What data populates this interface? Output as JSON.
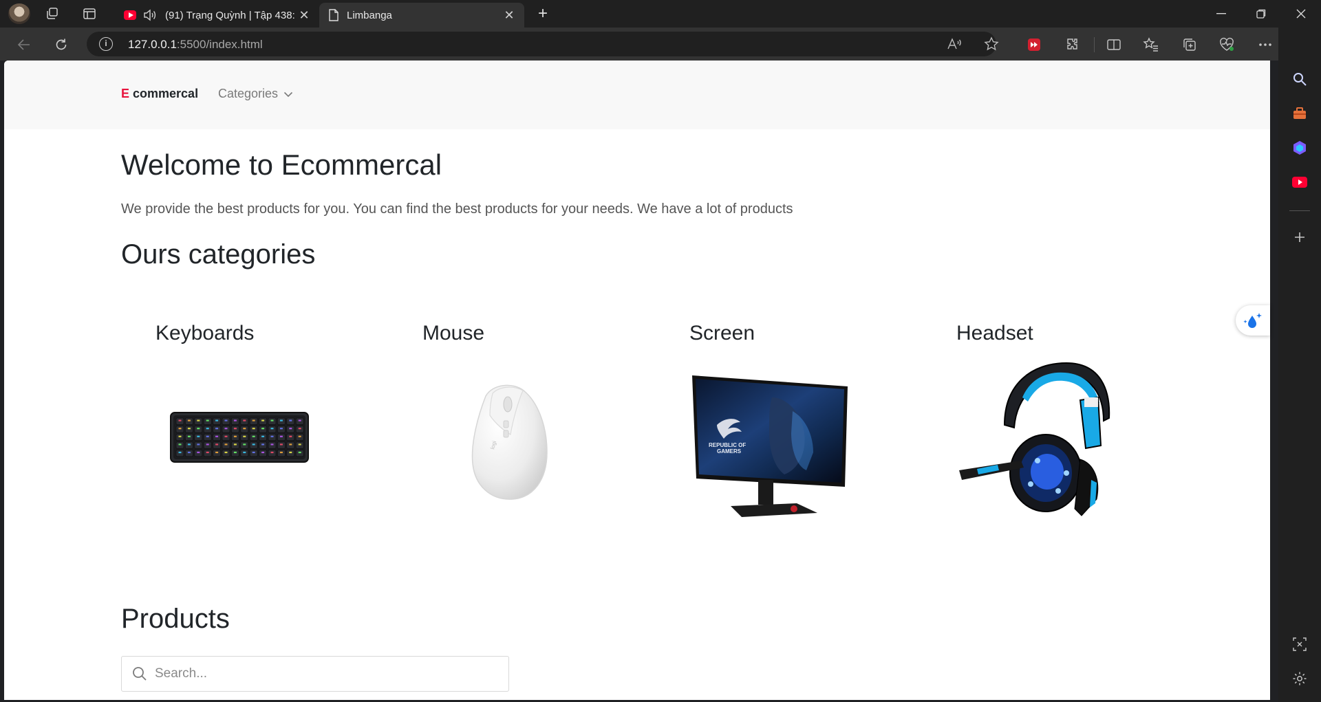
{
  "browser": {
    "tabs": [
      {
        "title": "(91) Trạng Quỳnh | Tập 438:",
        "favicon": "youtube-icon",
        "audio": true
      },
      {
        "title": "Limbanga",
        "favicon": "document-icon",
        "active": true
      }
    ],
    "address": {
      "host": "127.0.0.1",
      "path": ":5500/index.html"
    },
    "accent": "#ff0033"
  },
  "nav": {
    "brand_e": "E",
    "brand_rest": " commercal",
    "categories_label": "Categories"
  },
  "hero": {
    "title": "Welcome to Ecommercal",
    "lead": "We provide the best products for you. You can find the best products for your needs. We have a lot of products"
  },
  "categories": {
    "heading": "Ours categories",
    "items": [
      {
        "label": "Keyboards",
        "icon": "keyboard-image"
      },
      {
        "label": "Mouse",
        "icon": "mouse-image"
      },
      {
        "label": "Screen",
        "icon": "monitor-image"
      },
      {
        "label": "Headset",
        "icon": "headset-image"
      }
    ]
  },
  "products": {
    "heading": "Products",
    "search_placeholder": "Search..."
  },
  "colors": {
    "brand_red": "#e8123c",
    "text": "#212529",
    "nav_bg": "#f8f8f8"
  }
}
